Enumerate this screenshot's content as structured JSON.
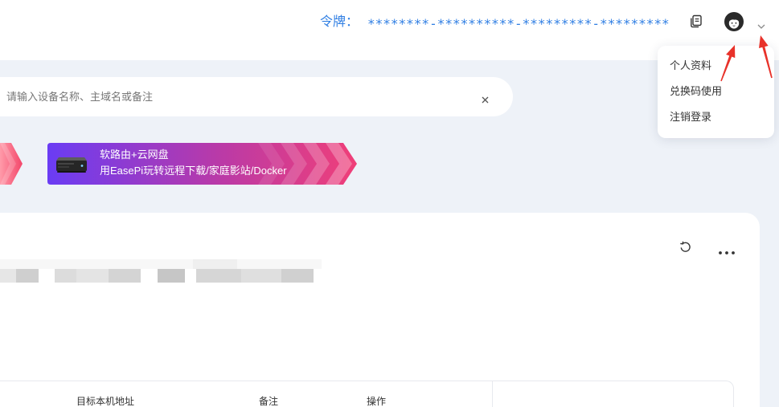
{
  "header": {
    "token_label": "令牌：",
    "token_value": "********-**********-*********-*********",
    "copy_icon": "copy-icon",
    "avatar": "user-avatar",
    "dropdown_icon": "chevron-down-icon"
  },
  "user_menu": {
    "items": [
      {
        "label": "个人资料"
      },
      {
        "label": "兑换码使用"
      },
      {
        "label": "注销登录"
      }
    ]
  },
  "search": {
    "placeholder": "请输入设备名称、主域名或备注",
    "clear_icon": "close-icon"
  },
  "banners": [
    {
      "image": "router-device-image",
      "title": "软路由+云网盘",
      "subtitle": "用EasePi玩转远程下载/家庭影站/Docker"
    }
  ],
  "device_card": {
    "refresh_icon": "refresh-icon",
    "more_icon": "more-icon"
  },
  "table": {
    "columns": [
      "目标本机地址",
      "备注",
      "操作"
    ]
  },
  "colors": {
    "accent": "#2f7ee3",
    "page_background": "#eef2f8",
    "banner_gradient_start": "#6a3cf4",
    "banner_gradient_end": "#f03f78",
    "annotation_red": "#e8322a"
  }
}
